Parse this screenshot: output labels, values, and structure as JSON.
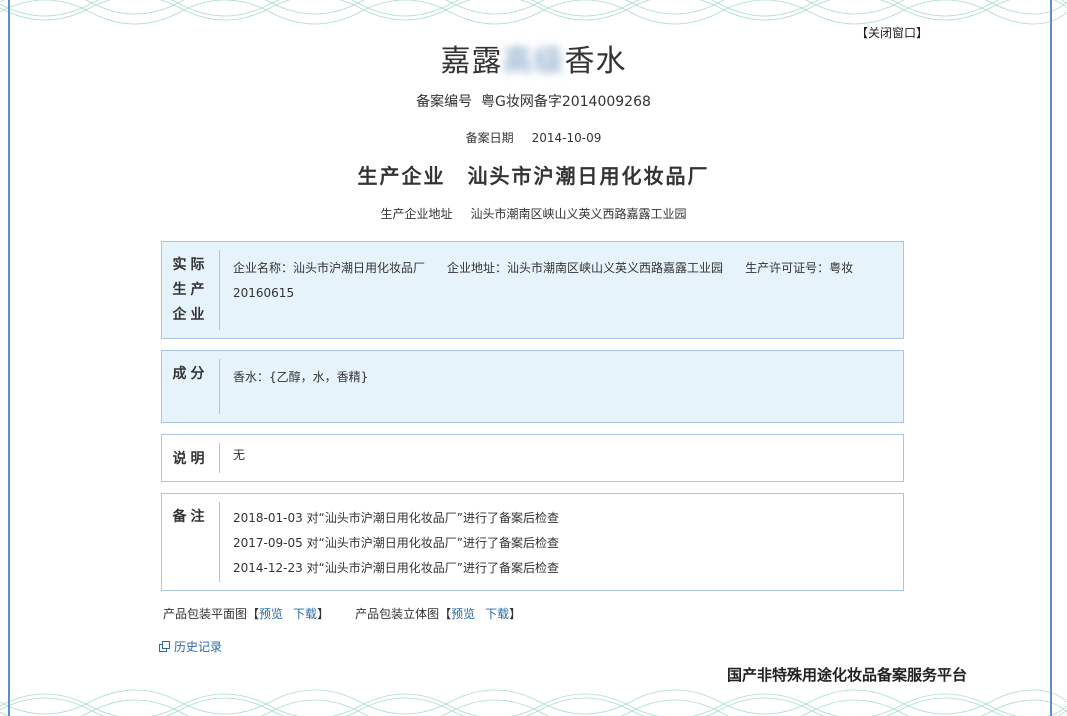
{
  "close_label": "【关闭窗口】",
  "product": {
    "name_prefix": "嘉露",
    "name_blurred": "高级",
    "name_suffix": "香水"
  },
  "record": {
    "number_label": "备案编号",
    "number_value": "粤G妆网备字2014009268",
    "date_label": "备案日期",
    "date_value": "2014-10-09"
  },
  "producer": {
    "label": "生产企业",
    "name": "汕头市沪潮日用化妆品厂",
    "address_label": "生产企业地址",
    "address": "汕头市潮南区峡山义英义西路嘉露工业园"
  },
  "actual_producer": {
    "label": "实际生产企业",
    "company_name_label": "企业名称：",
    "company_name": "汕头市沪潮日用化妆品厂",
    "company_addr_label": "企业地址：",
    "company_addr": "汕头市潮南区峡山义英义西路嘉露工业园",
    "license_label": "生产许可证号：",
    "license": "粤妆20160615"
  },
  "ingredients": {
    "label": "成分",
    "value": "香水：{乙醇，水，香精}"
  },
  "description": {
    "label": "说明",
    "value": "无"
  },
  "remarks": {
    "label": "备注",
    "items": [
      "2018-01-03 对“汕头市沪潮日用化妆品厂”进行了备案后检查",
      "2017-09-05 对“汕头市沪潮日用化妆品厂”进行了备案后检查",
      "2014-12-23 对“汕头市沪潮日用化妆品厂”进行了备案后检查"
    ]
  },
  "packaging": {
    "flat_label": "产品包装平面图",
    "three_d_label": "产品包装立体图",
    "bracket_open": "【",
    "bracket_close": "】",
    "preview": "预览",
    "download": "下载"
  },
  "history_label": "历史记录",
  "platform_name": "国产非特殊用途化妆品备案服务平台",
  "colors": {
    "frame": "#5a8fc9",
    "box_border": "#a9c6e2",
    "box_fill": "#e7f3fb",
    "link": "#2a6aa5",
    "wave": "#a9dccb"
  }
}
